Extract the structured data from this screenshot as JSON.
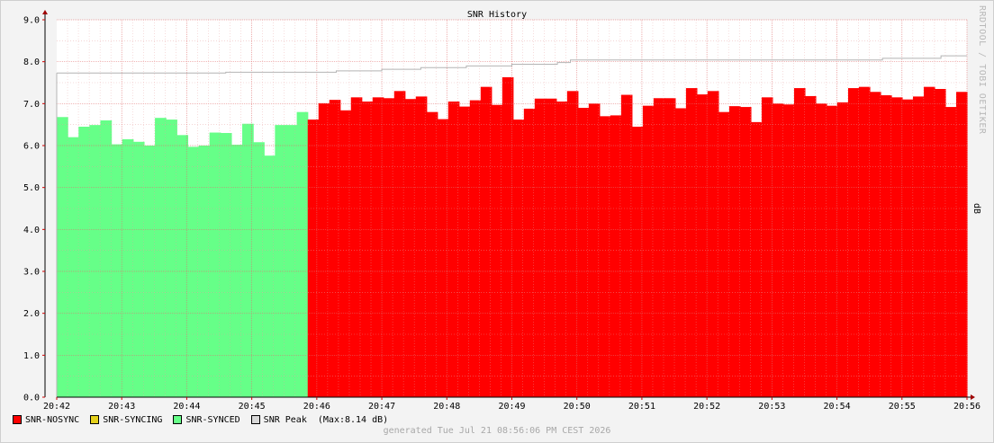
{
  "chart_data": {
    "type": "area",
    "title": "SNR History",
    "ylabel": "dB",
    "ylim": [
      0,
      9
    ],
    "yticks": [
      {
        "v": 0,
        "label": "0.0"
      },
      {
        "v": 1,
        "label": "1.0"
      },
      {
        "v": 2,
        "label": "2.0"
      },
      {
        "v": 3,
        "label": "3.0"
      },
      {
        "v": 4,
        "label": "4.0"
      },
      {
        "v": 5,
        "label": "5.0"
      },
      {
        "v": 6,
        "label": "6.0"
      },
      {
        "v": 7,
        "label": "7.0"
      },
      {
        "v": 8,
        "label": "8.0"
      },
      {
        "v": 9,
        "label": "9.0"
      }
    ],
    "xlim": [
      0,
      14
    ],
    "xticks": [
      {
        "v": 0,
        "label": "20:42"
      },
      {
        "v": 1,
        "label": "20:43"
      },
      {
        "v": 2,
        "label": "20:44"
      },
      {
        "v": 3,
        "label": "20:45"
      },
      {
        "v": 4,
        "label": "20:46"
      },
      {
        "v": 5,
        "label": "20:47"
      },
      {
        "v": 6,
        "label": "20:48"
      },
      {
        "v": 7,
        "label": "20:49"
      },
      {
        "v": 8,
        "label": "20:50"
      },
      {
        "v": 9,
        "label": "20:51"
      },
      {
        "v": 10,
        "label": "20:52"
      },
      {
        "v": 11,
        "label": "20:53"
      },
      {
        "v": 12,
        "label": "20:54"
      },
      {
        "v": 13,
        "label": "20:55"
      },
      {
        "v": 14,
        "label": "20:56"
      }
    ],
    "series": [
      {
        "name": "SNR-SYNCED",
        "color": "#66ff88",
        "values": [
          6.68,
          6.2,
          6.45,
          6.49,
          6.6,
          6.03,
          6.15,
          6.09,
          6.0,
          6.66,
          6.62,
          6.25,
          5.97,
          6.0,
          6.31,
          6.3,
          6.02,
          6.52,
          6.08,
          5.76,
          6.49,
          6.49,
          6.8
        ]
      },
      {
        "name": "SNR-NOSYNC",
        "color": "#ff0000",
        "values": [
          6.62,
          7.01,
          7.09,
          6.84,
          7.15,
          7.05,
          7.15,
          7.13,
          7.3,
          7.11,
          7.17,
          6.8,
          6.63,
          7.05,
          6.93,
          7.08,
          7.4,
          6.97,
          7.63,
          6.62,
          6.88,
          7.12,
          7.12,
          7.05,
          7.3,
          6.9,
          7.0,
          6.7,
          6.72,
          7.21,
          6.45,
          6.95,
          7.13,
          7.13,
          6.89,
          7.37,
          7.22,
          7.3,
          6.8,
          6.94,
          6.92,
          6.56,
          7.15,
          7.0,
          6.98,
          7.37,
          7.18,
          7.0,
          6.95,
          7.03,
          7.37,
          7.4,
          7.28,
          7.2,
          7.15,
          7.1,
          7.17,
          7.4,
          7.35,
          6.92,
          7.28
        ]
      },
      {
        "name": "SNR-SYNCING",
        "color": "#e5d11c",
        "values": []
      },
      {
        "name": "SNR Peak",
        "color": "#c8c8c8",
        "steps": [
          {
            "x": 0.0,
            "y": 7.73
          },
          {
            "x": 2.6,
            "y": 7.75
          },
          {
            "x": 4.3,
            "y": 7.78
          },
          {
            "x": 5.0,
            "y": 7.82
          },
          {
            "x": 5.6,
            "y": 7.86
          },
          {
            "x": 6.3,
            "y": 7.9
          },
          {
            "x": 7.0,
            "y": 7.94
          },
          {
            "x": 7.7,
            "y": 7.98
          },
          {
            "x": 7.9,
            "y": 8.04
          },
          {
            "x": 12.7,
            "y": 8.08
          },
          {
            "x": 13.6,
            "y": 8.14
          },
          {
            "x": 14.0,
            "y": 8.14
          }
        ]
      }
    ],
    "legend": [
      {
        "name": "SNR-NOSYNC",
        "color": "#ff0000"
      },
      {
        "name": "SNR-SYNCING",
        "color": "#e5d11c"
      },
      {
        "name": "SNR-SYNCED",
        "color": "#66ff88"
      },
      {
        "name": "SNR Peak",
        "color": "#d8d8d8",
        "note": "(Max:8.14 dB)"
      }
    ],
    "grid": true,
    "legend_position": "bottom-left"
  },
  "footer": "generated Tue Jul 21 08:56:06 PM CEST 2026",
  "watermark": "RRDTOOL / TOBI OETIKER"
}
